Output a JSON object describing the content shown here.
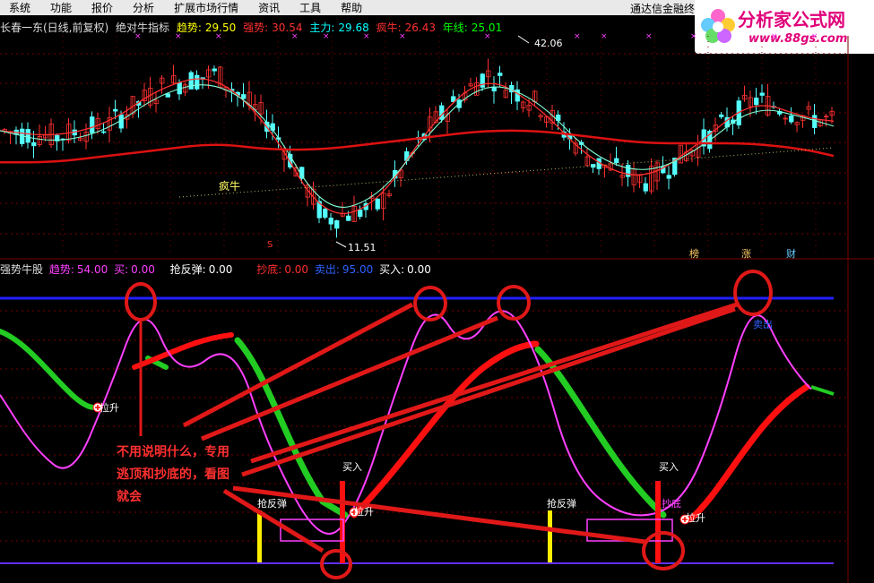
{
  "menu": [
    "系统",
    "功能",
    "报价",
    "分析",
    "扩展市场行情",
    "资讯",
    "工具",
    "帮助"
  ],
  "menu_right": "通达信金融终",
  "logo": {
    "title": "分析家公式网",
    "url": "www.88gs.com"
  },
  "main_info": {
    "name": "长春一东(日线,前复权)",
    "indicator": "绝对牛指标",
    "items": [
      {
        "label": "趋势:",
        "value": "29.50",
        "color": "#ffff00"
      },
      {
        "label": "强势:",
        "value": "30.54",
        "color": "#ff3030"
      },
      {
        "label": "主力:",
        "value": "29.68",
        "color": "#00ffff"
      },
      {
        "label": "疯牛:",
        "value": "26.43",
        "color": "#ff3030"
      },
      {
        "label": "年线:",
        "value": "25.01",
        "color": "#00ff00"
      }
    ]
  },
  "sub_info": {
    "name": "强势牛股",
    "items": [
      {
        "label": "趋势:",
        "value": "54.00",
        "color": "#ff40ff"
      },
      {
        "label": "买:",
        "value": "0.00",
        "color": "#ff40ff"
      },
      {
        "label": "抢反弹:",
        "value": "0.00",
        "color": "#ffffff"
      },
      {
        "label": "抄底:",
        "value": "0.00",
        "color": "#ff3030"
      },
      {
        "label": "卖出:",
        "value": "95.00",
        "color": "#3060ff"
      },
      {
        "label": "买入:",
        "value": "0.00",
        "color": "#ffffff"
      }
    ]
  },
  "labels": {
    "high": "42.06",
    "low": "11.51",
    "crazy_bull": "疯牛",
    "up1": "拉升",
    "up2": "拉升",
    "up3": "拉升",
    "rebound1": "抢反弹",
    "rebound2": "抢反弹",
    "buy1": "买入",
    "buy2": "买入",
    "bottom": "抄底",
    "sell": "卖出",
    "tag1": "榜",
    "tag2": "涨",
    "tag3": "财",
    "s_mark": "S"
  },
  "annotation": "不用说明什么，专用\n逃顶和抄底的，看图\n就会",
  "colors": {
    "background": "#000000",
    "up_candle": "#ff3030",
    "down_candle": "#54ffff",
    "trend_line": "#ff40ff",
    "green_band": "#22cc22",
    "red_band": "#ff1010",
    "sell_line": "#2020ff"
  },
  "chart_data": [
    {
      "type": "line",
      "title": "绝对牛指标",
      "x": [
        0,
        60,
        120,
        180,
        240,
        300,
        360,
        420,
        480,
        540,
        600,
        660,
        720,
        780,
        840,
        900,
        930
      ],
      "series": [
        {
          "name": "强势",
          "values": [
            29,
            28,
            30,
            36,
            38,
            30,
            15,
            17,
            30,
            38,
            33,
            24,
            21,
            27,
            34,
            31,
            30.5
          ]
        },
        {
          "name": "主力",
          "values": [
            29,
            27,
            29,
            35,
            37,
            31,
            16,
            18,
            29,
            37,
            34,
            25,
            22,
            26,
            33,
            31,
            29.7
          ]
        },
        {
          "name": "年线",
          "values": [
            24,
            24,
            25,
            26,
            27,
            26,
            26,
            27,
            28,
            29,
            29,
            28,
            27,
            27,
            27,
            26,
            25
          ]
        }
      ],
      "ylim": [
        10,
        44
      ]
    },
    {
      "type": "line",
      "title": "强势牛股",
      "x": [
        0,
        40,
        80,
        120,
        160,
        200,
        260,
        300,
        360,
        400,
        440,
        480,
        520,
        560,
        600,
        640,
        700,
        760,
        800,
        840,
        880,
        930
      ],
      "series": [
        {
          "name": "趋势",
          "values": [
            60,
            40,
            30,
            60,
            95,
            65,
            80,
            40,
            5,
            20,
            60,
            95,
            75,
            95,
            75,
            30,
            15,
            20,
            50,
            97,
            70,
            54
          ]
        }
      ],
      "ylim": [
        0,
        100
      ]
    }
  ]
}
